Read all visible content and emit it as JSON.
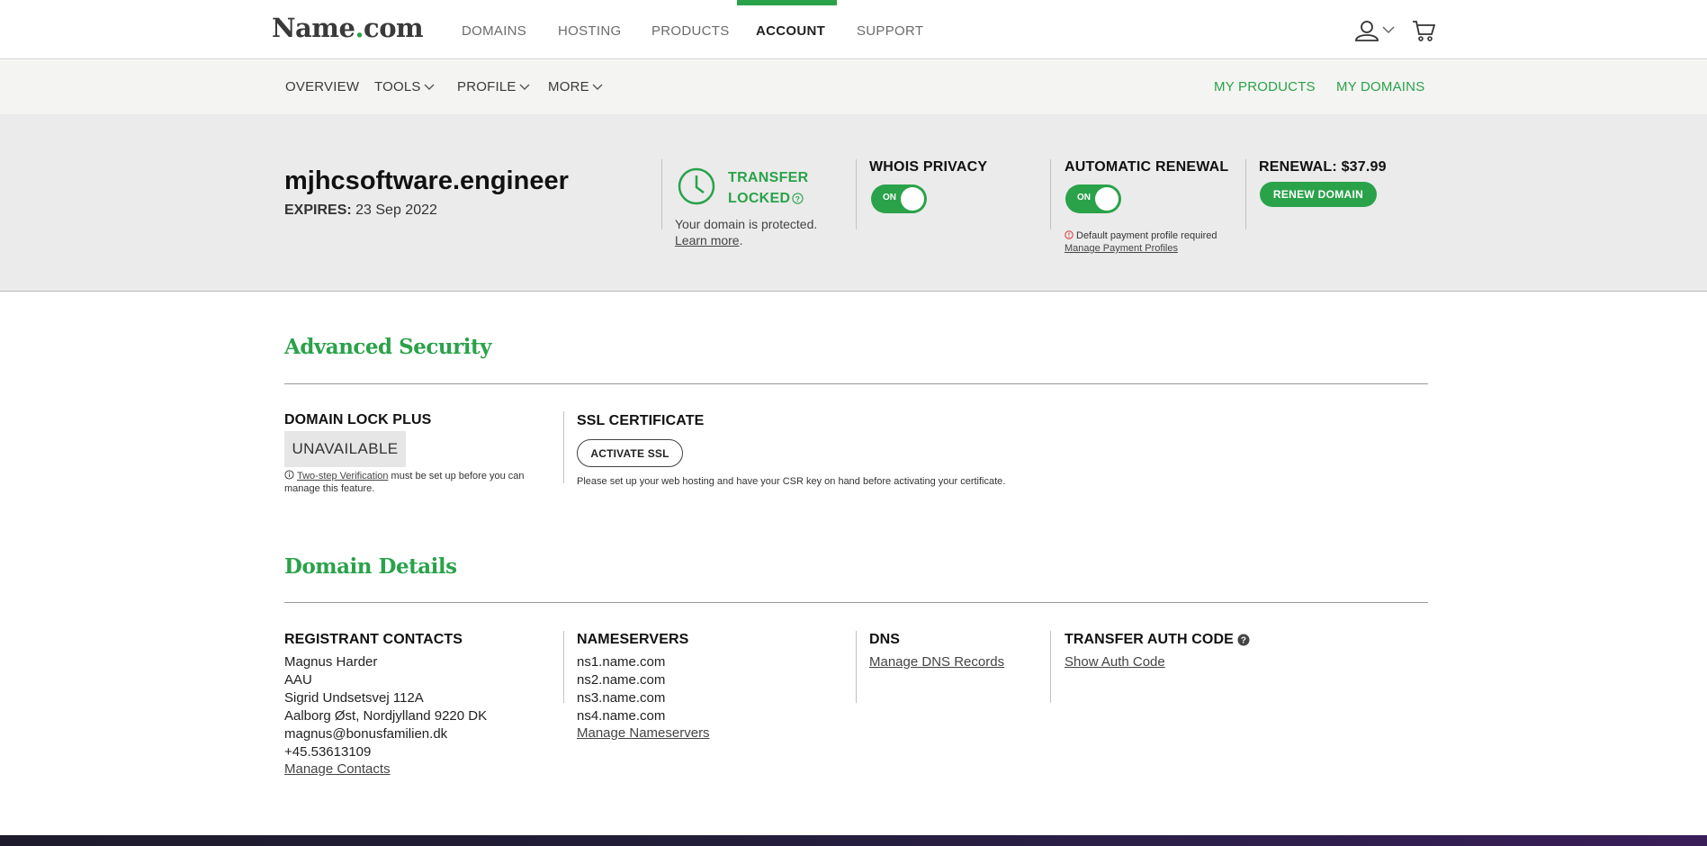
{
  "brand": {
    "name_part1": "Name",
    "dot": ".",
    "name_part2": "com",
    "accent": "#2aa24a"
  },
  "topnav": {
    "items": [
      {
        "label": "DOMAINS"
      },
      {
        "label": "HOSTING"
      },
      {
        "label": "PRODUCTS"
      },
      {
        "label": "ACCOUNT",
        "active": true
      },
      {
        "label": "SUPPORT"
      }
    ],
    "icons": [
      "user-icon",
      "chevron-down-icon",
      "cart-icon"
    ]
  },
  "subnav": {
    "left": [
      {
        "label": "OVERVIEW"
      },
      {
        "label": "TOOLS"
      },
      {
        "label": "PROFILE"
      },
      {
        "label": "MORE"
      }
    ],
    "right": [
      {
        "label": "MY PRODUCTS"
      },
      {
        "label": "MY DOMAINS"
      }
    ]
  },
  "domain": {
    "name": "mjhcsoftware.engineer",
    "expires_label": "EXPIRES:",
    "expires_value": "23 Sep 2022"
  },
  "transfer": {
    "status_line1": "TRANSFER",
    "status_line2": "LOCKED",
    "protected_text": "Your domain is protected.",
    "learn_more": "Learn more"
  },
  "whois": {
    "label": "WHOIS PRIVACY",
    "toggle": "ON"
  },
  "auto_renew": {
    "label": "AUTOMATIC RENEWAL",
    "toggle": "ON",
    "note": "Default payment profile required",
    "manage_link": "Manage Payment Profiles"
  },
  "renewal": {
    "label": "RENEWAL: $37.99",
    "button": "RENEW DOMAIN"
  },
  "advanced_security": {
    "title": "Advanced Security",
    "lock_label": "DOMAIN LOCK PLUS",
    "lock_status": "UNAVAILABLE",
    "lock_note_link": "Two-step Verification",
    "lock_note_rest": " must be set up before you can manage this feature.",
    "ssl_label": "SSL CERTIFICATE",
    "ssl_button": "ACTIVATE SSL",
    "ssl_note": "Please set up your web hosting and have your CSR key on hand before activating your certificate."
  },
  "domain_details": {
    "title": "Domain Details",
    "registrant": {
      "label": "REGISTRANT CONTACTS",
      "lines": [
        "Magnus Harder",
        "AAU",
        "Sigrid Undsetsvej 112A",
        "Aalborg Øst, Nordjylland 9220 DK",
        "magnus@bonusfamilien.dk",
        "+45.53613109"
      ],
      "manage": "Manage Contacts"
    },
    "nameservers": {
      "label": "NAMESERVERS",
      "lines": [
        "ns1.name.com",
        "ns2.name.com",
        "ns3.name.com",
        "ns4.name.com"
      ],
      "manage": "Manage Nameservers"
    },
    "dns": {
      "label": "DNS",
      "manage": "Manage DNS Records"
    },
    "auth": {
      "label": "TRANSFER AUTH CODE",
      "show": "Show Auth Code"
    }
  }
}
